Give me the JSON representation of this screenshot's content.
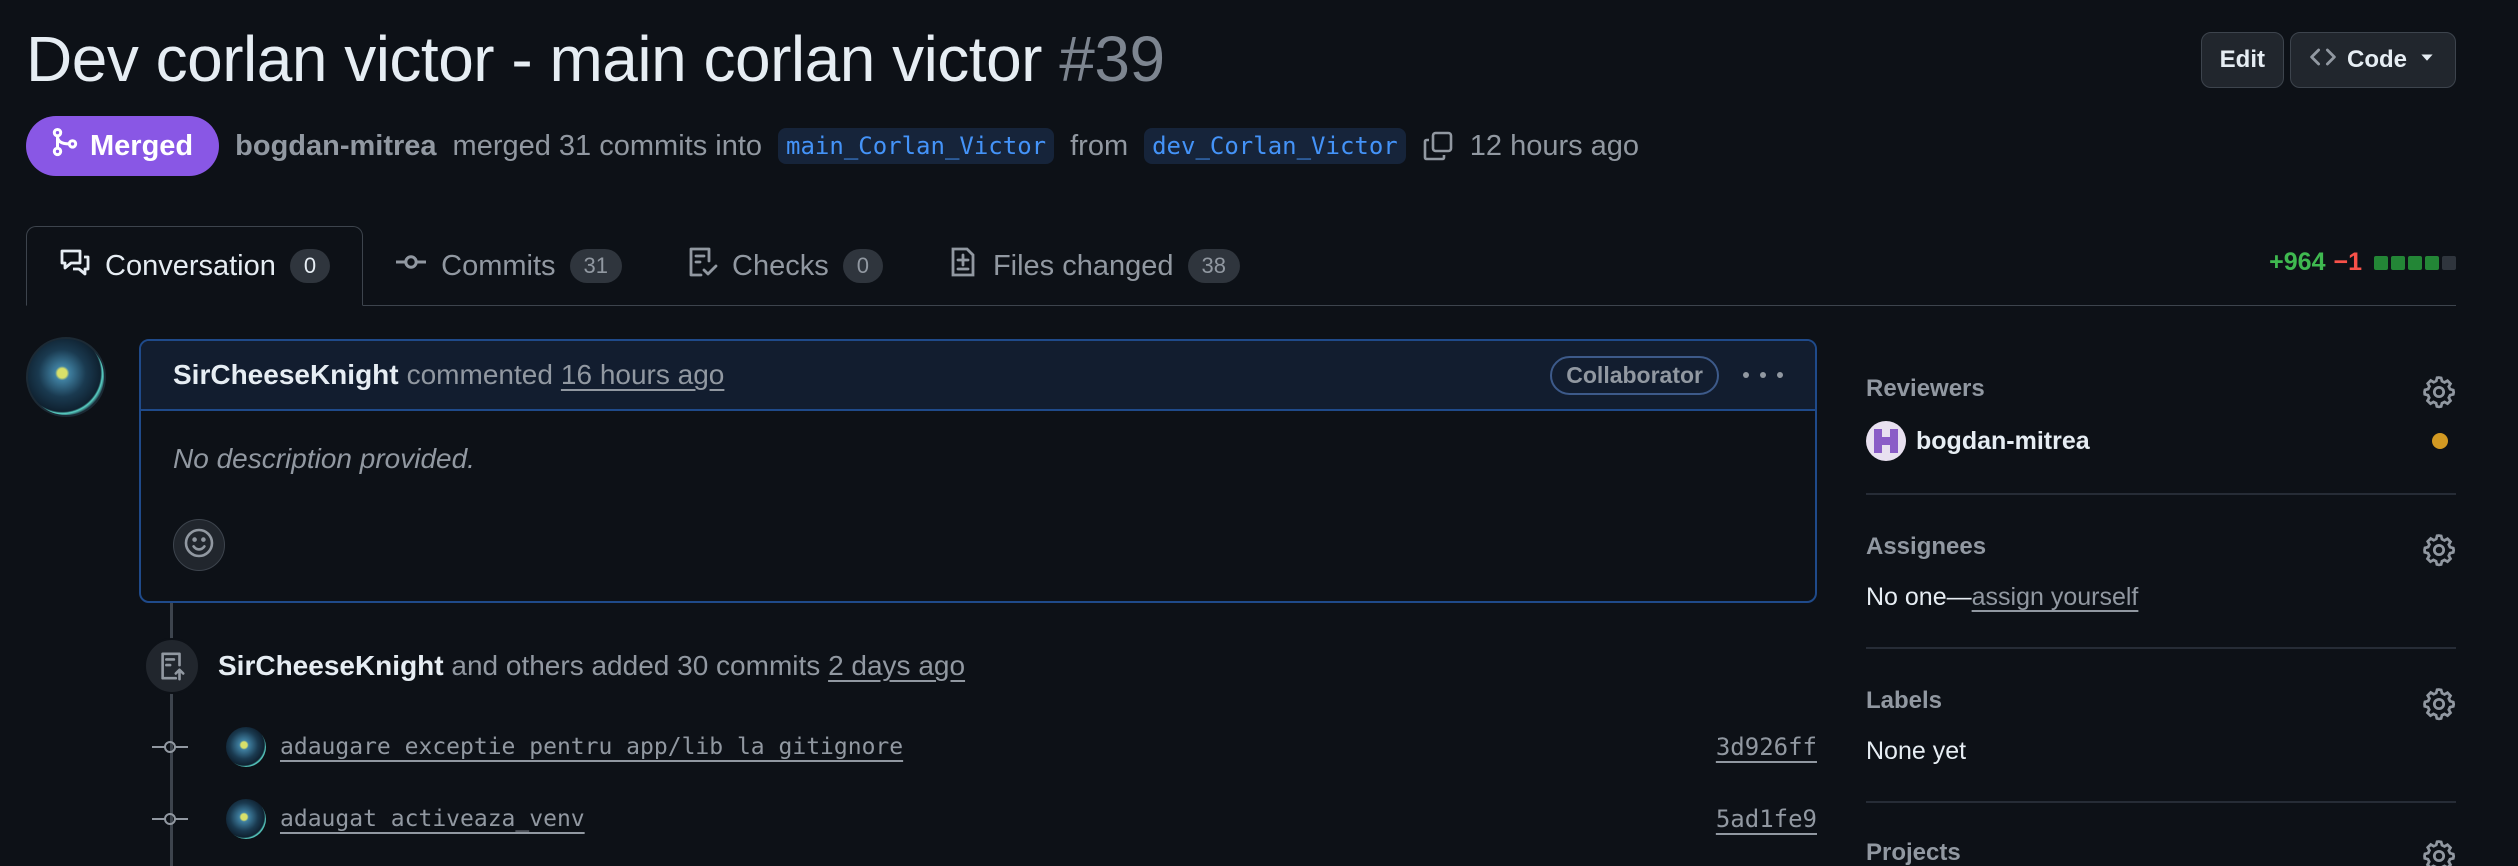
{
  "pr": {
    "title": "Dev corlan victor - main corlan victor",
    "number": "#39",
    "state": "Merged",
    "author": "bogdan-mitrea",
    "merged_text": "merged 31 commits into",
    "base_branch": "main_Corlan_Victor",
    "from_text": "from",
    "head_branch": "dev_Corlan_Victor",
    "time": "12 hours ago"
  },
  "header_actions": {
    "edit_label": "Edit",
    "code_label": "Code"
  },
  "tabs": [
    {
      "label": "Conversation",
      "count": "0",
      "icon": "comment-discussion-icon",
      "active": true
    },
    {
      "label": "Commits",
      "count": "31",
      "icon": "git-commit-icon",
      "active": false
    },
    {
      "label": "Checks",
      "count": "0",
      "icon": "checklist-icon",
      "active": false
    },
    {
      "label": "Files changed",
      "count": "38",
      "icon": "file-diff-icon",
      "active": false
    }
  ],
  "diffstat": {
    "additions": "+964",
    "deletions": "−1",
    "filled_blocks": 4,
    "total_blocks": 5
  },
  "comment": {
    "author": "SirCheeseKnight",
    "action": "commented",
    "time": "16 hours ago",
    "role": "Collaborator",
    "body": "No description provided."
  },
  "push_event": {
    "author": "SirCheeseKnight",
    "text": "and others added 30 commits",
    "time": "2 days ago"
  },
  "commits": [
    {
      "message": "adaugare exceptie pentru app/lib la gitignore",
      "sha": "3d926ff"
    },
    {
      "message": "adaugat activeaza_venv",
      "sha": "5ad1fe9"
    }
  ],
  "sidebar": {
    "reviewers": {
      "title": "Reviewers",
      "name": "bogdan-mitrea"
    },
    "assignees": {
      "title": "Assignees",
      "value": "No one—",
      "link": "assign yourself"
    },
    "labels": {
      "title": "Labels",
      "value": "None yet"
    },
    "projects": {
      "title": "Projects"
    }
  },
  "colors": {
    "background": "#0d1117",
    "merged": "#8957e5",
    "additions": "#3fb950",
    "deletions": "#f85149",
    "branch": "#4493f8",
    "pending": "#d29922"
  }
}
